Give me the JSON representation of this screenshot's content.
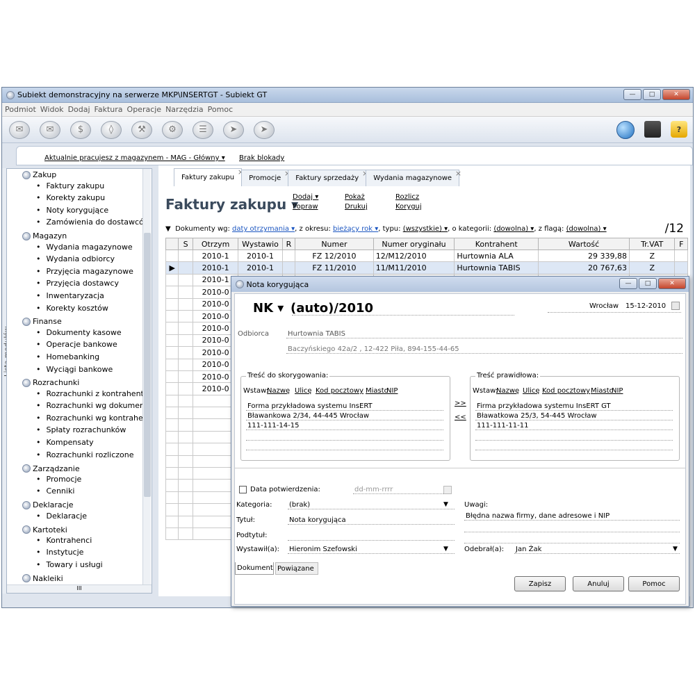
{
  "window": {
    "title": "Subiekt demonstracyjny na serwerze MKP\\INSERTGT - Subiekt GT"
  },
  "menu": [
    "Podmiot",
    "Widok",
    "Dodaj",
    "Faktura",
    "Operacje",
    "Narzędzia",
    "Pomoc"
  ],
  "status": {
    "warehouse": "Aktualnie pracujesz z magazynem - MAG - Główny ▾",
    "lock": "Brak blokady"
  },
  "sidebar": {
    "vertical_label": "Lista modułów",
    "groups": [
      {
        "label": "Zakup",
        "items": [
          "Faktury zakupu",
          "Korekty zakupu",
          "Noty korygujące",
          "Zamówienia do dostawców"
        ]
      },
      {
        "label": "Magazyn",
        "items": [
          "Wydania magazynowe",
          "Wydania odbiorcy",
          "Przyjęcia magazynowe",
          "Przyjęcia dostawcy",
          "Inwentaryzacja",
          "Korekty kosztów"
        ]
      },
      {
        "label": "Finanse",
        "items": [
          "Dokumenty kasowe",
          "Operacje bankowe",
          "Homebanking",
          "Wyciągi bankowe"
        ]
      },
      {
        "label": "Rozrachunki",
        "items": [
          "Rozrachunki z kontrahentem",
          "Rozrachunki wg dokumentów",
          "Rozrachunki wg kontrahentów",
          "Spłaty rozrachunków",
          "Kompensaty",
          "Rozrachunki rozliczone"
        ]
      },
      {
        "label": "Zarządzanie",
        "items": [
          "Promocje",
          "Cenniki"
        ]
      },
      {
        "label": "Deklaracje",
        "items": [
          "Deklaracje"
        ]
      },
      {
        "label": "Kartoteki",
        "items": [
          "Kontrahenci",
          "Instytucje",
          "Towary i usługi"
        ]
      },
      {
        "label": "Nakleiki",
        "items": []
      }
    ]
  },
  "tabs": [
    "Faktury zakupu",
    "Promocje",
    "Faktury sprzedaży",
    "Wydania magazynowe"
  ],
  "page": {
    "title": "Faktury zakupu ▾",
    "actions": {
      "dodaj": "Dodaj ▾",
      "popraw": "Popraw",
      "pokaz": "Pokaż",
      "drukuj": "Drukuj",
      "rozlicz": "Rozlicz",
      "koryguj": "Koryguj"
    }
  },
  "filter": {
    "prefix": "Dokumenty wg:",
    "by": "daty otrzymania ▾",
    "period_label": ", z okresu:",
    "period": "bieżący rok ▾",
    "type_label": ", typu:",
    "type": "(wszystkie) ▾",
    "category_label": ", o kategorii:",
    "category": "(dowolna) ▾",
    "flag_label": ", z flagą:",
    "flag": "(dowolna) ▾",
    "count": "/12"
  },
  "table": {
    "headers": [
      "",
      "S",
      "Otrzym",
      "Wystawio",
      "R",
      "Numer",
      "Numer oryginału",
      "Kontrahent",
      "Wartość",
      "Tr.VAT",
      "F"
    ],
    "rows": [
      [
        "",
        "",
        "2010-1",
        "2010-1",
        "",
        "FZ 12/2010",
        "12/M12/2010",
        "Hurtownia ALA",
        "29 339,88",
        "Z",
        ""
      ],
      [
        "▶",
        "",
        "2010-1",
        "2010-1",
        "",
        "FZ 11/2010",
        "11/M11/2010",
        "Hurtownia TABIS",
        "20 767,63",
        "Z",
        ""
      ],
      [
        "",
        "",
        "2010-1",
        "",
        "",
        "",
        "",
        "",
        "",
        "",
        ""
      ],
      [
        "",
        "",
        "2010-0",
        "",
        "",
        "",
        "",
        "",
        "",
        "",
        ""
      ],
      [
        "",
        "",
        "2010-0",
        "",
        "",
        "",
        "",
        "",
        "",
        "",
        ""
      ],
      [
        "",
        "",
        "2010-0",
        "",
        "",
        "",
        "",
        "",
        "",
        "",
        ""
      ],
      [
        "",
        "",
        "2010-0",
        "",
        "",
        "",
        "",
        "",
        "",
        "",
        ""
      ],
      [
        "",
        "",
        "2010-0",
        "",
        "",
        "",
        "",
        "",
        "",
        "",
        ""
      ],
      [
        "",
        "",
        "2010-0",
        "",
        "",
        "",
        "",
        "",
        "",
        "",
        ""
      ],
      [
        "",
        "",
        "2010-0",
        "",
        "",
        "",
        "",
        "",
        "",
        "",
        ""
      ],
      [
        "",
        "",
        "2010-0",
        "",
        "",
        "",
        "",
        "",
        "",
        "",
        ""
      ],
      [
        "",
        "",
        "2010-0",
        "",
        "",
        "",
        "",
        "",
        "",
        "",
        ""
      ]
    ]
  },
  "dialog": {
    "title": "Nota korygująca",
    "doc_type": "NK ▾",
    "number": "(auto)/2010",
    "place": "Wrocław",
    "date": "15-12-2010",
    "recipient_label": "Odbiorca",
    "recipient_name": "Hurtownia TABIS",
    "recipient_addr": "Baczyńskiego 42a/2 , 12-422 Piła, 894-155-44-65",
    "left_group": "Treść do skorygowania:",
    "right_group": "Treść prawidłowa:",
    "insert_label": "Wstaw:",
    "insert_links": [
      "Nazwę",
      "Ulicę",
      "Kod pocztowy",
      "Miasto",
      "NIP"
    ],
    "wrong_lines": [
      "Forma przykładowa systemu InsERT",
      "Bławankowa 2/34, 44-445 Wrocław",
      "111-111-14-15"
    ],
    "correct_lines": [
      "Firma przykładowa systemu InsERT GT",
      "Bławatkowa 25/3, 54-445 Wrocław",
      "111-111-11-11"
    ],
    "arrow_right": ">>",
    "arrow_left": "<<",
    "confirm_label": "Data potwierdzenia:",
    "confirm_placeholder": "dd-mm-rrrr",
    "category_label": "Kategoria:",
    "category_value": "(brak)",
    "title_label": "Tytuł:",
    "title_value": "Nota korygująca",
    "subtitle_label": "Podtytuł:",
    "issuer_label": "Wystawił(a):",
    "issuer_value": "Hieronim Szefowski",
    "remarks_label": "Uwagi:",
    "remarks_value": "Błędna nazwa firmy, dane adresowe i NIP",
    "receiver_label": "Odebrał(a):",
    "receiver_value": "Jan Żak",
    "bottom_tabs": [
      "Dokument",
      "Powiązane"
    ],
    "buttons": {
      "save": "Zapisz",
      "cancel": "Anuluj",
      "help": "Pomoc"
    }
  }
}
